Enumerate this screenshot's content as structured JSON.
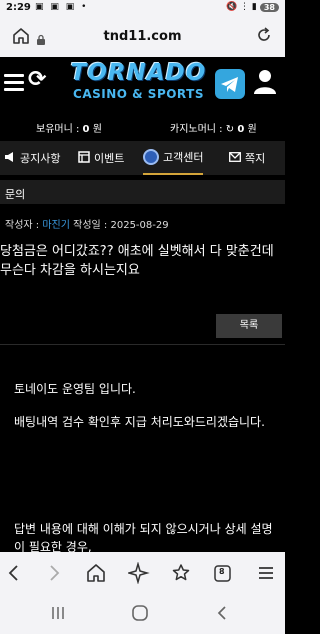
{
  "status_bar": {
    "time": "2:29",
    "left_icons": "▣ ▣ ▣ •",
    "right_icons": "🔇 ⋮ ▮",
    "battery": "38"
  },
  "browser": {
    "url": "tnd11.com",
    "home_icon": "home-icon",
    "lock_icon": "lock-icon",
    "reload_icon": "reload-icon"
  },
  "site": {
    "logo_line1": "TORNADO",
    "logo_line2": "CASINO & SPORTS",
    "menu_icon": "hamburger-icon",
    "refresh_icon": "refresh-icon",
    "telegram_icon": "telegram-icon",
    "user_icon": "user-icon",
    "brand_color": "#49b7f0"
  },
  "money": {
    "holding_label": "보유머니 :",
    "holding_value": "0",
    "holding_unit": "원",
    "casino_label": "카지노머니 :",
    "casino_refresh_icon": "↻",
    "casino_value": "0",
    "casino_unit": "원"
  },
  "nav": {
    "items": [
      {
        "label": "공지사항",
        "icon": "megaphone-icon",
        "glyph": "📢"
      },
      {
        "label": "이벤트",
        "icon": "event-grid-icon",
        "glyph": "▦"
      },
      {
        "label": "고객센터",
        "icon": "headset-icon",
        "glyph": "",
        "active": true
      },
      {
        "label": "쪽지",
        "icon": "envelope-icon",
        "glyph": "✉"
      }
    ],
    "active_color": "#d4a53a"
  },
  "post": {
    "section_title": "문의",
    "author_label": "작성자 :",
    "author_name": "마진기",
    "date_label": "작성일 :",
    "date_value": "2025-08-29",
    "title_line1": "당첨금은 어디갔죠?? 애초에 실벳해서 다 맞춘건데",
    "title_line2": "무슨다 차감을 하시는지요",
    "list_button": "목록"
  },
  "reply": {
    "greeting": "토네이도 운영팀 입니다.",
    "body1": "배팅내역 검수 확인후 지급 처리도와드리겠습니다.",
    "body2": "답변 내용에 대해 이해가 되지 않으시거나 상세 설명이 필요한 경우,"
  },
  "toolbar": {
    "back_icon": "back-icon",
    "forward_icon": "forward-icon",
    "home_icon": "home-icon",
    "sparkle_icon": "sparkle-icon",
    "bookmark_icon": "bookmark-star-icon",
    "tabs_count": "8",
    "menu_icon": "menu-icon"
  }
}
